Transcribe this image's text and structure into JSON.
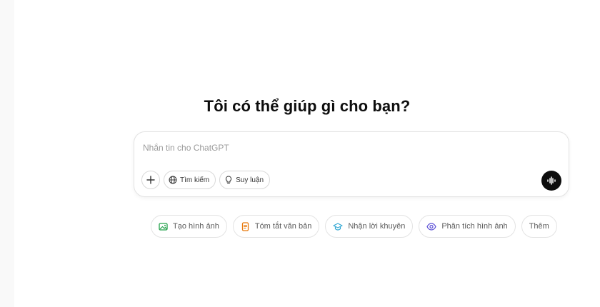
{
  "main": {
    "heading": "Tôi có thể giúp gì cho bạn?"
  },
  "composer": {
    "placeholder": "Nhắn tin cho ChatGPT",
    "tools": {
      "search_label": "Tìm kiếm",
      "reason_label": "Suy luận"
    }
  },
  "suggestions": [
    {
      "label": "Tạo hình ảnh",
      "icon": "image-icon",
      "color": "#23a14b"
    },
    {
      "label": "Tóm tắt văn bản",
      "icon": "document-icon",
      "color": "#e8790c"
    },
    {
      "label": "Nhận lời khuyên",
      "icon": "graduation-cap-icon",
      "color": "#35a9d4"
    },
    {
      "label": "Phân tích hình ảnh",
      "icon": "eye-icon",
      "color": "#5b4fd6"
    },
    {
      "label": "Thêm",
      "icon": "",
      "color": ""
    }
  ]
}
